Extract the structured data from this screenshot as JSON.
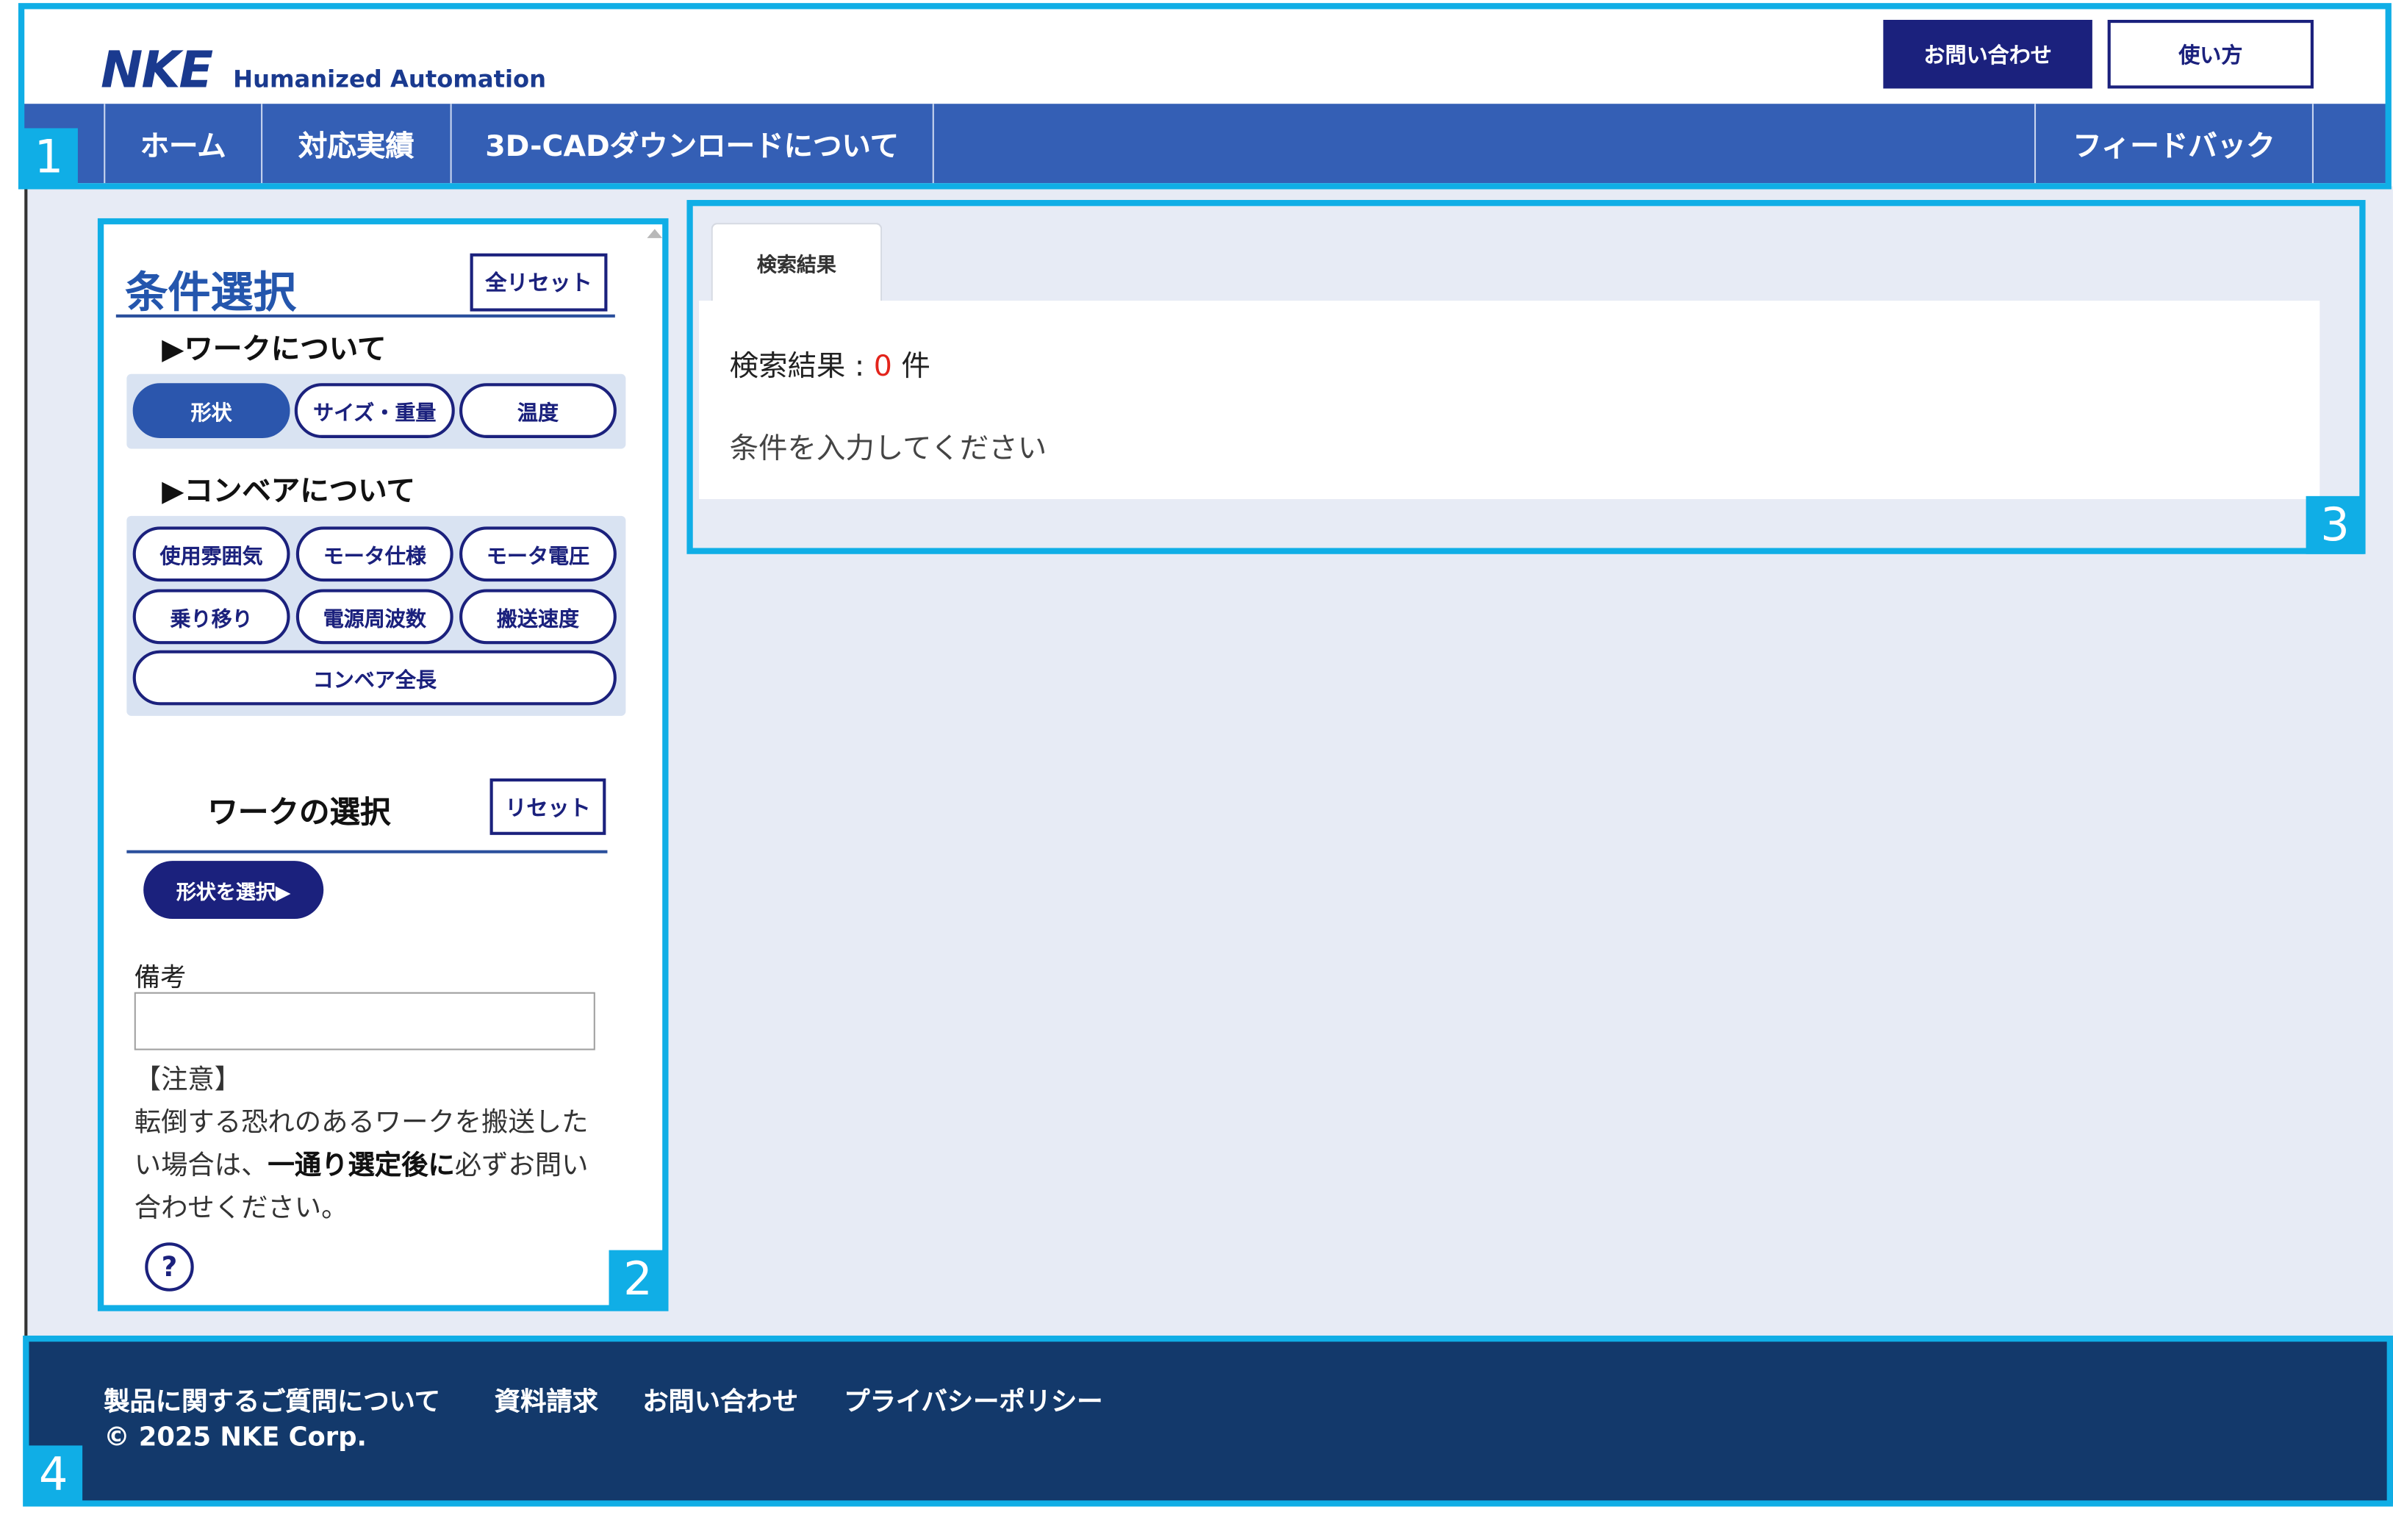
{
  "header": {
    "logo_mark": "NKE",
    "logo_sub": "Humanized Automation",
    "contact_label": "お問い合わせ",
    "howto_label": "使い方"
  },
  "nav": {
    "home": "ホーム",
    "results": "対応実績",
    "cad": "3D-CADダウンロードについて",
    "feedback": "フィードバック"
  },
  "conditions": {
    "title": "条件選択",
    "reset_all_label": "全リセット",
    "work_section": "▶ワークについて",
    "work_chips": [
      "形状",
      "サイズ・重量",
      "温度"
    ],
    "conveyor_section": "▶コンベアについて",
    "conveyor_chips": [
      "使用雰囲気",
      "モータ仕様",
      "モータ電圧",
      "乗り移り",
      "電源周波数",
      "搬送速度",
      "コンベア全長"
    ],
    "work_select_title": "ワークの選択",
    "reset_label": "リセット",
    "shape_button": "形状を選択▶",
    "notes_label": "備考",
    "notes_value": "",
    "caution_heading": "【注意】",
    "caution_text_1": "転倒する恐れのあるワークを搬送したい場合は、",
    "caution_text_bold": "一通り選定後に",
    "caution_text_2": "必ずお問い合わせください。",
    "help_icon_glyph": "?"
  },
  "results": {
    "tab_label": "検索結果",
    "count_prefix": "検索結果 : ",
    "count_value": "0",
    "count_suffix": " 件",
    "message": "条件を入力してください"
  },
  "footer": {
    "links": [
      "製品に関するご質問について",
      "資料請求",
      "お問い合わせ",
      "プライバシーポリシー"
    ],
    "copyright": "© 2025 NKE Corp."
  },
  "annotations": [
    "1",
    "2",
    "3",
    "4"
  ],
  "colors": {
    "nav_bg": "#345fb5",
    "brand_navy": "#1b217d",
    "footer_bg": "#13396b",
    "annotation": "#10aee6",
    "count_red": "#e3241b"
  }
}
